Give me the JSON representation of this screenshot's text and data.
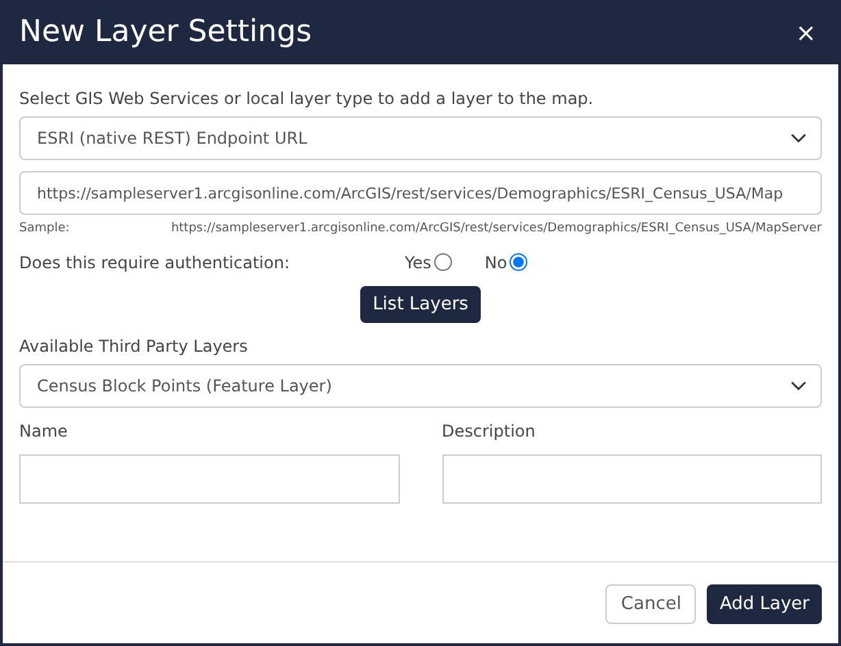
{
  "dialog": {
    "title": "New Layer Settings",
    "close": "×"
  },
  "intro": "Select GIS Web Services or local layer type to add a layer to the map.",
  "layer_type": {
    "value": "ESRI (native REST) Endpoint URL"
  },
  "endpoint_url": {
    "value": "https://sampleserver1.arcgisonline.com/ArcGIS/rest/services/Demographics/ESRI_Census_USA/Map"
  },
  "sample": {
    "label": "Sample:",
    "url": "https://sampleserver1.arcgisonline.com/ArcGIS/rest/services/Demographics/ESRI_Census_USA/MapServer"
  },
  "authentication": {
    "question": "Does this require authentication:",
    "options": [
      {
        "label": "Yes",
        "selected": false
      },
      {
        "label": "No",
        "selected": true
      }
    ]
  },
  "list_button": "List Layers",
  "third_party": {
    "label": "Available Third Party Layers",
    "value": "Census Block Points (Feature Layer)"
  },
  "fields": [
    {
      "label": "Name"
    },
    {
      "label": "Description"
    }
  ],
  "footer_buttons": [
    {
      "label": "Cancel",
      "kind": "secondary"
    },
    {
      "label": "Add Layer",
      "kind": "primary"
    }
  ]
}
